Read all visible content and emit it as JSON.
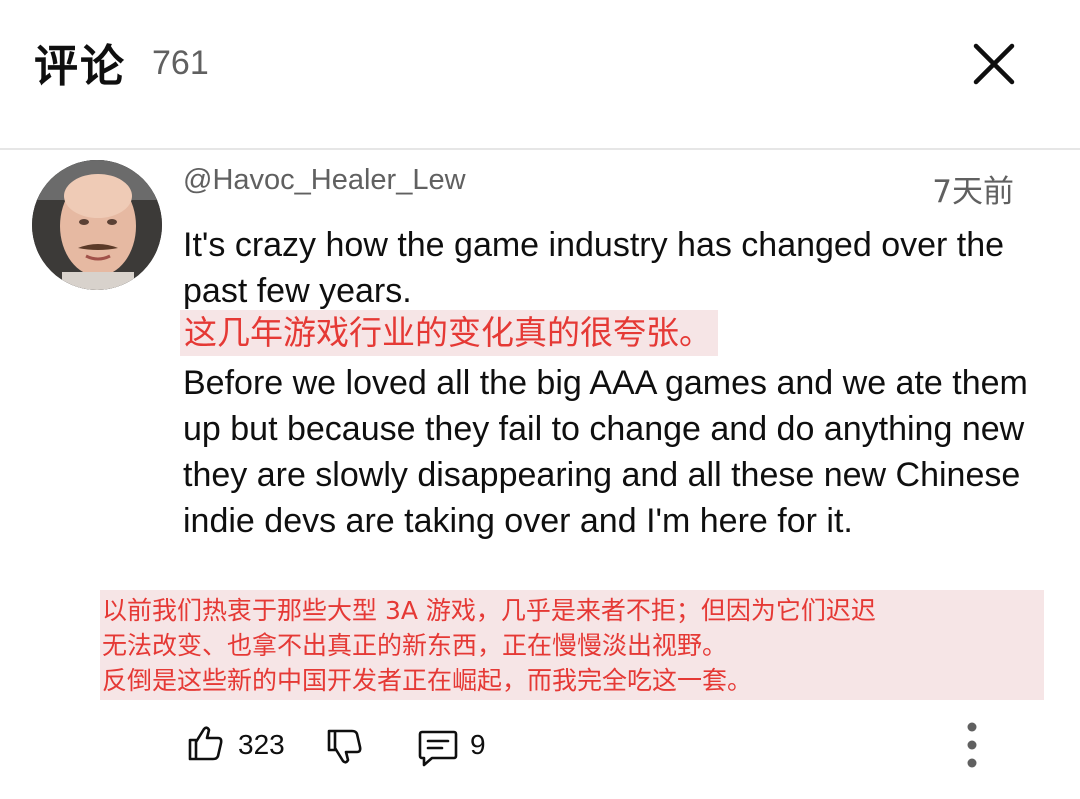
{
  "header": {
    "title": "评论",
    "count": "761"
  },
  "comment": {
    "author": "@Havoc_Healer_Lew",
    "time": "7天前",
    "text_en_1": "It's crazy how the game industry has changed over the past few years.",
    "translation_1": "这几年游戏行业的变化真的很夸张。",
    "text_en_2": "Before we loved all the big AAA games and we ate them up but because they fail to change and do anything new they are slowly disappearing and all these new Chinese indie devs are taking over and I'm here for it.",
    "translation_2": [
      "以前我们热衷于那些大型 3A 游戏，几乎是来者不拒；但因为它们迟迟",
      "无法改变、也拿不出真正的新东西，正在慢慢淡出视野。",
      "反倒是这些新的中国开发者正在崛起，而我完全吃这一套。"
    ],
    "likes": "323",
    "replies": "9"
  },
  "icons": {
    "close": "close-icon",
    "like": "thumbs-up-icon",
    "dislike": "thumbs-down-icon",
    "reply": "comment-icon",
    "more": "more-vertical-icon"
  },
  "colors": {
    "translation_text": "#e53935",
    "translation_bg": "#f6e5e6",
    "secondary_text": "#606060"
  }
}
